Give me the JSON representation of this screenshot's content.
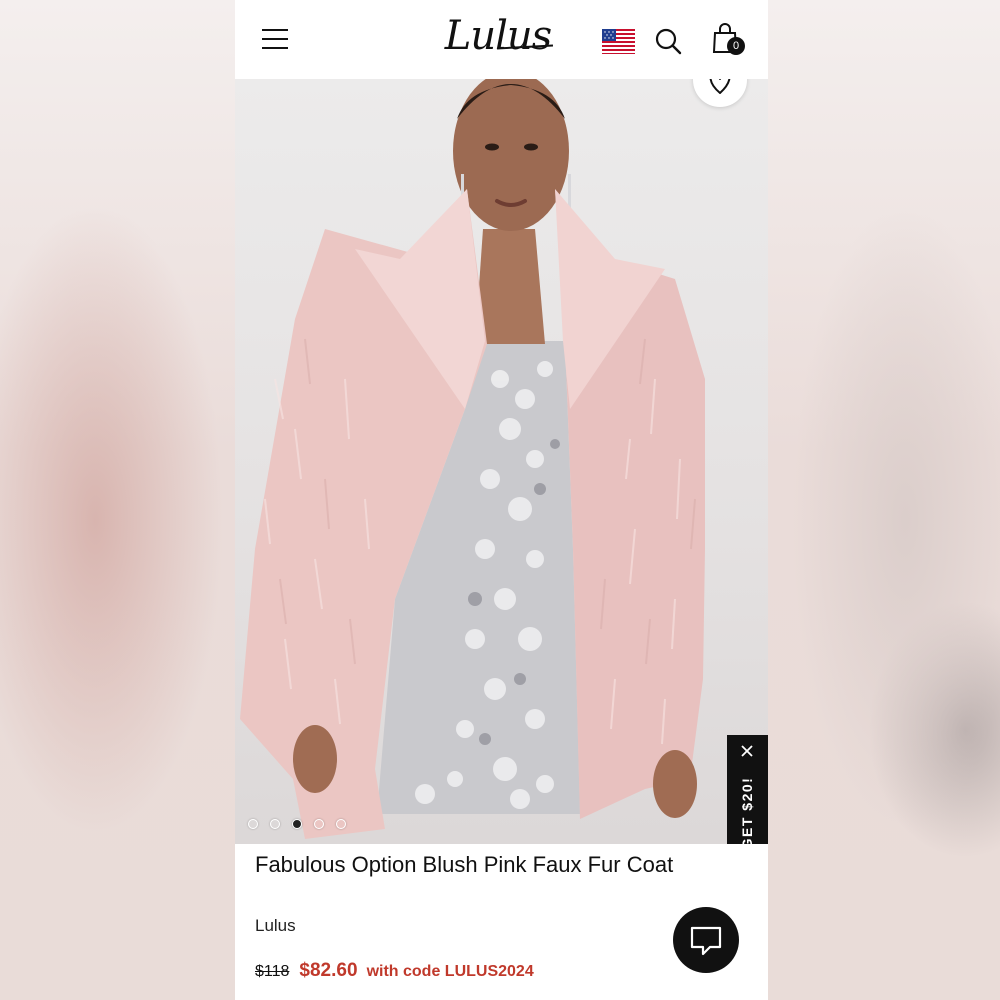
{
  "header": {
    "logo_text": "Lulus",
    "cart_count": "0",
    "icons": [
      "menu-icon",
      "us-flag-icon",
      "search-icon",
      "shopping-bag-icon"
    ]
  },
  "gallery": {
    "image_count": 5,
    "active_index": 2,
    "wishlist_icon": "heart-icon"
  },
  "promo_tab": {
    "label": "GET $20!",
    "close_icon": "close-icon"
  },
  "product": {
    "title": "Fabulous Option Blush Pink Faux Fur Coat",
    "brand": "Lulus",
    "original_price": "$118",
    "sale_price": "$82.60",
    "promo_text": "with code LULUS2024"
  },
  "chat": {
    "icon": "chat-bubble-icon"
  },
  "colors": {
    "sale_red": "#c0392b",
    "coat_pink": "#ebc6c3",
    "header_bg": "#ffffff",
    "tab_black": "#111111"
  }
}
